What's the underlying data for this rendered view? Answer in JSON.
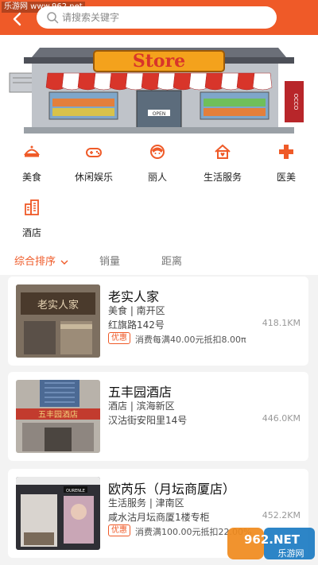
{
  "watermark_top": "乐游网 www.962.net",
  "search": {
    "placeholder": "请搜索关键字"
  },
  "banner": {
    "sign_text": "Store",
    "door_text": "OPEN",
    "side_flag": "OCCO"
  },
  "categories": [
    {
      "label": "美食",
      "icon": "dish-icon"
    },
    {
      "label": "休闲娱乐",
      "icon": "gamepad-icon"
    },
    {
      "label": "丽人",
      "icon": "beauty-icon"
    },
    {
      "label": "生活服务",
      "icon": "home-service-icon"
    },
    {
      "label": "医美",
      "icon": "medical-cross-icon"
    },
    {
      "label": "酒店",
      "icon": "hotel-icon"
    }
  ],
  "sort": {
    "tabs": [
      "综合排序",
      "销量",
      "距离"
    ],
    "active": 0
  },
  "listings": [
    {
      "name": "老实人家",
      "sub": "美食 | 南开区",
      "addr": "红旗路142号",
      "dist": "418.1KM",
      "badge": "优惠",
      "promo": "消费每满40.00元抵扣8.00π",
      "thumb_text": "老实人家"
    },
    {
      "name": "五丰园酒店",
      "sub": "酒店 | 滨海新区",
      "addr": "汉沽街安阳里14号",
      "dist": "446.0KM",
      "badge": "",
      "promo": "",
      "thumb_text": "五丰园酒店"
    },
    {
      "name": "欧芮乐（月坛商厦店）",
      "sub": "生活服务 | 津南区",
      "addr": "咸水沽月坛商厦1楼专柜",
      "dist": "452.2KM",
      "badge": "优惠",
      "promo": "消费满100.00元抵扣22.00%",
      "thumb_text": "OURENLE"
    }
  ],
  "watermark_logo": {
    "text": "962.NET",
    "sub": "乐游网"
  },
  "colors": {
    "brand": "#ef5a28",
    "awning_red": "#d8352a",
    "awning_white": "#ffffff",
    "roof": "#6b6f78"
  }
}
